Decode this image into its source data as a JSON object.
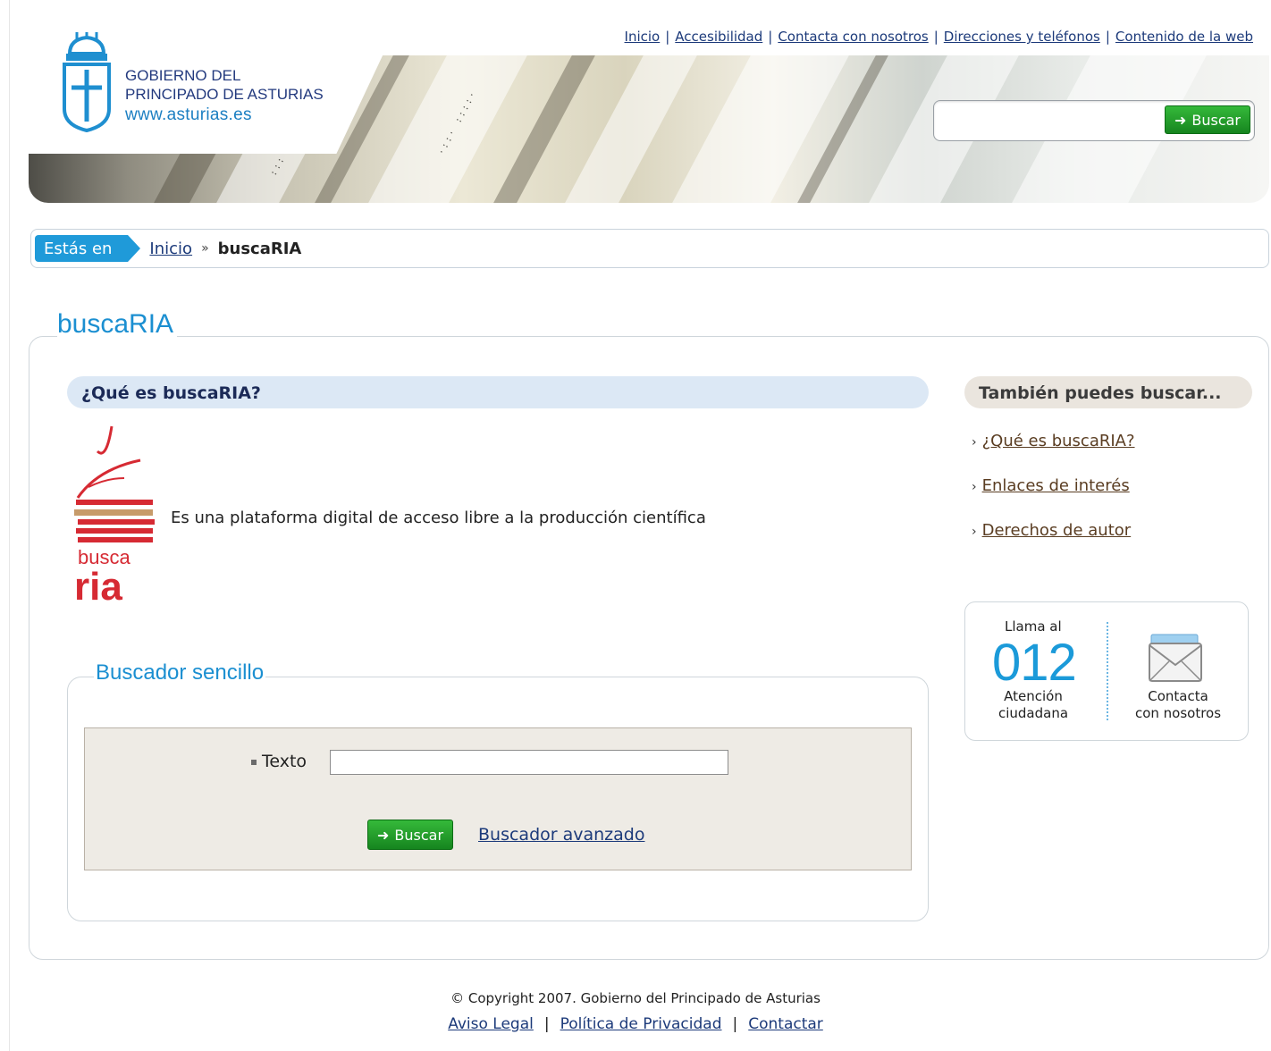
{
  "header": {
    "gov_name_line1": "GOBIERNO DEL",
    "gov_name_line2": "PRINCIPADO DE ASTURIAS",
    "gov_url": "www.asturias.es",
    "top_links": [
      "Inicio",
      "Accesibilidad",
      "Contacta con nosotros",
      "Direcciones y teléfonos",
      "Contenido de la web"
    ],
    "search": {
      "placeholder": "",
      "value": "",
      "button_label": "Buscar"
    }
  },
  "breadcrumb": {
    "label": "Estás en",
    "home": "Inicio",
    "separator": "»",
    "current": "buscaRIA"
  },
  "main": {
    "title": "buscaRIA",
    "section_title": "¿Qué es buscaRIA?",
    "logo_text_line1": "busca",
    "logo_text_line2": "ria",
    "description": "Es una plataforma digital de acceso libre a la producción científica",
    "simple_search": {
      "legend": "Buscador sencillo",
      "text_label": "Texto",
      "text_value": "",
      "button_label": "Buscar",
      "advanced_link": "Buscador avanzado"
    }
  },
  "sidebar": {
    "title": "También puedes buscar...",
    "links": [
      "¿Qué es buscaRIA?",
      "Enlaces de interés",
      "Derechos de autor"
    ],
    "contact": {
      "call_label": "Llama al",
      "number": "012",
      "attention_line1": "Atención",
      "attention_line2": "ciudadana",
      "contact_line1": "Contacta",
      "contact_line2": "con nosotros"
    }
  },
  "footer": {
    "copyright": "© Copyright 2007. Gobierno del Principado de Asturias",
    "links": [
      "Aviso Legal",
      "Política de Privacidad",
      "Contactar"
    ]
  },
  "colors": {
    "accent_blue": "#1b8fd1",
    "button_green": "#1f9c28",
    "brand_red": "#d62a33"
  }
}
